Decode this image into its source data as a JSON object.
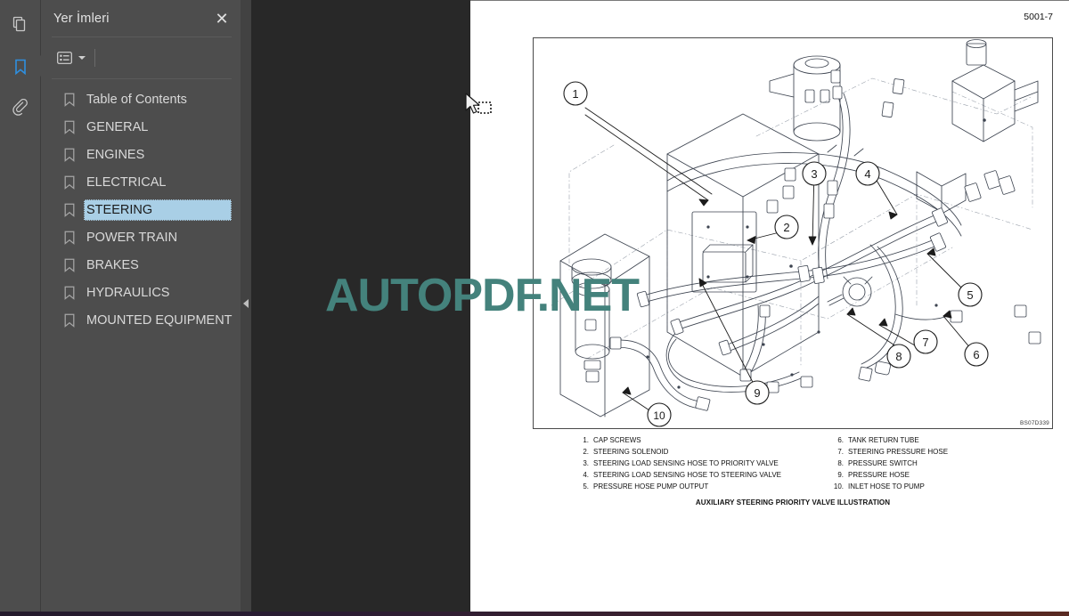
{
  "rail": {
    "items": [
      {
        "name": "pages-thumbnails-icon",
        "label": "Pages"
      },
      {
        "name": "bookmarks-icon",
        "label": "Bookmarks"
      },
      {
        "name": "attachments-icon",
        "label": "Attachments"
      }
    ]
  },
  "panel": {
    "title": "Yer İmleri",
    "close_label": "✕",
    "list_options_label": "Options"
  },
  "bookmarks": [
    {
      "label": "Table of Contents",
      "selected": false
    },
    {
      "label": "GENERAL",
      "selected": false
    },
    {
      "label": "ENGINES",
      "selected": false
    },
    {
      "label": "ELECTRICAL",
      "selected": false
    },
    {
      "label": "STEERING",
      "selected": true
    },
    {
      "label": "POWER TRAIN",
      "selected": false
    },
    {
      "label": "BRAKES",
      "selected": false
    },
    {
      "label": "HYDRAULICS",
      "selected": false
    },
    {
      "label": "MOUNTED EQUIPMENT",
      "selected": false
    }
  ],
  "document": {
    "page_number": "5001-7",
    "figure_code": "BS07D339",
    "caption": "AUXILIARY STEERING PRIORITY VALVE ILLUSTRATION",
    "legend_left": [
      {
        "num": "1.",
        "text": "CAP SCREWS"
      },
      {
        "num": "2.",
        "text": "STEERING SOLENOID"
      },
      {
        "num": "3.",
        "text": "STEERING LOAD SENSING HOSE TO PRIORITY VALVE"
      },
      {
        "num": "4.",
        "text": "STEERING LOAD SENSING HOSE TO STEERING VALVE"
      },
      {
        "num": "5.",
        "text": "PRESSURE HOSE PUMP OUTPUT"
      }
    ],
    "legend_right": [
      {
        "num": "6.",
        "text": "TANK RETURN TUBE"
      },
      {
        "num": "7.",
        "text": "STEERING PRESSURE HOSE"
      },
      {
        "num": "8.",
        "text": "PRESSURE SWITCH"
      },
      {
        "num": "9.",
        "text": "PRESSURE HOSE"
      },
      {
        "num": "10.",
        "text": "INLET HOSE TO PUMP"
      }
    ],
    "callouts": [
      "1",
      "2",
      "3",
      "4",
      "5",
      "6",
      "7",
      "8",
      "9",
      "10"
    ]
  },
  "watermark": {
    "text": "AUTOPDF.NET",
    "color": "#44827c"
  },
  "colors": {
    "panel_bg": "#4d4d4d",
    "viewer_bg": "#282828",
    "accent_blue": "#2e8fe0",
    "selection_blue": "#a9cfe6",
    "page_white": "#ffffff"
  }
}
